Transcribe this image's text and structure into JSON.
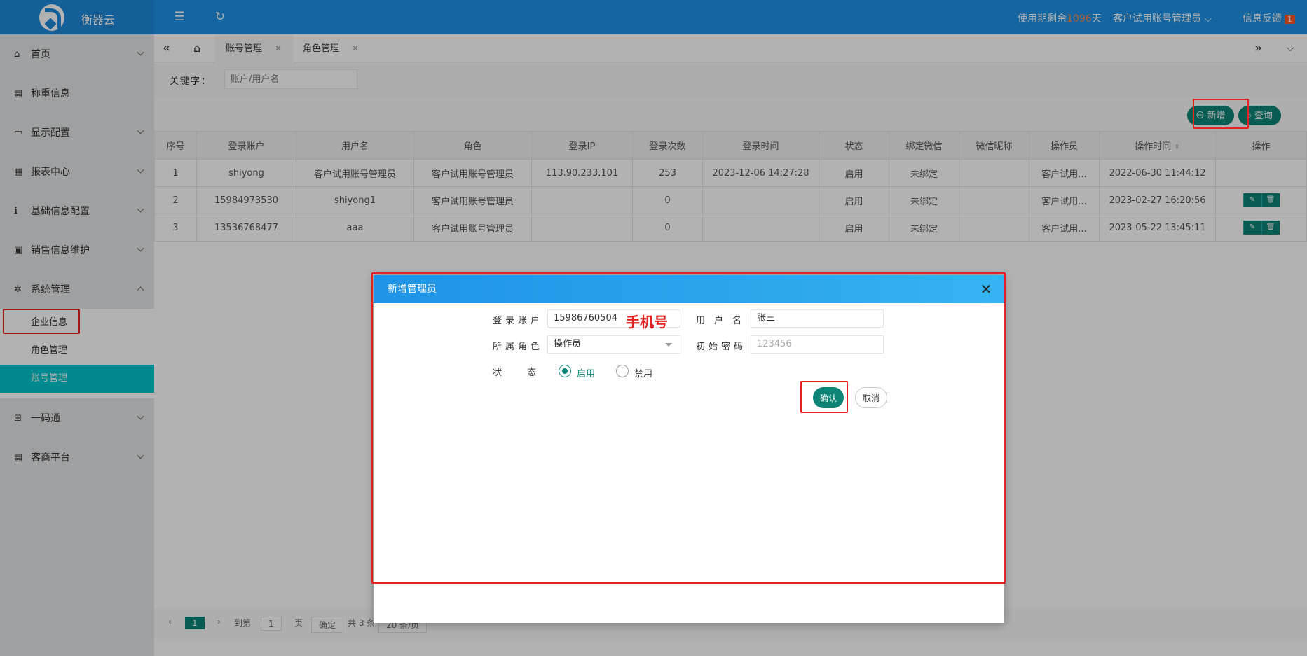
{
  "app": {
    "title": "衡器云"
  },
  "header": {
    "trial_prefix": "使用期剩余",
    "trial_days": "1096",
    "trial_suffix": "天",
    "user": "客户试用账号管理员",
    "feedback": "信息反馈",
    "feedback_count": "1"
  },
  "sidebar": {
    "items": [
      {
        "label": "首页",
        "icon": "home-icon"
      },
      {
        "label": "称重信息",
        "icon": "weigh-icon"
      },
      {
        "label": "显示配置",
        "icon": "monitor-icon"
      },
      {
        "label": "报表中心",
        "icon": "report-icon"
      },
      {
        "label": "基础信息配置",
        "icon": "info-icon"
      },
      {
        "label": "销售信息维护",
        "icon": "sales-icon"
      },
      {
        "label": "系统管理",
        "icon": "gear-icon"
      },
      {
        "label": "一码通",
        "icon": "qrcode-icon"
      },
      {
        "label": "客商平台",
        "icon": "platform-icon"
      }
    ],
    "sub_items": [
      "企业信息",
      "角色管理",
      "账号管理"
    ]
  },
  "tabs": [
    "账号管理",
    "角色管理"
  ],
  "search": {
    "label": "关键字：",
    "placeholder": "账户/用户名"
  },
  "toolbar": {
    "add": "新增",
    "query": "查询"
  },
  "table": {
    "headers": [
      "序号",
      "登录账户",
      "用户名",
      "角色",
      "登录IP",
      "登录次数",
      "登录时间",
      "状态",
      "绑定微信",
      "微信昵称",
      "操作员",
      "操作时间",
      "操作"
    ],
    "rows": [
      [
        "1",
        "shiyong",
        "客户试用账号管理员",
        "客户试用账号管理员",
        "113.90.233.101",
        "253",
        "2023-12-06 14:27:28",
        "启用",
        "未绑定",
        "",
        "客户试用...",
        "2022-06-30 11:44:12"
      ],
      [
        "2",
        "15984973530",
        "shiyong1",
        "客户试用账号管理员",
        "",
        "0",
        "",
        "启用",
        "未绑定",
        "",
        "客户试用...",
        "2023-02-27 16:20:56"
      ],
      [
        "3",
        "13536768477",
        "aaa",
        "客户试用账号管理员",
        "",
        "0",
        "",
        "启用",
        "未绑定",
        "",
        "客户试用...",
        "2023-05-22 13:45:11"
      ]
    ]
  },
  "pager": {
    "current": "1",
    "goto": "到第",
    "page_value": "1",
    "page_unit": "页",
    "confirm": "确定",
    "total": "共 3 条",
    "per_page": "20 条/页"
  },
  "dialog": {
    "title": "新增管理员",
    "account_label": "登录账户",
    "account_value": "15986760504",
    "note": "手机号",
    "username_label": "用户名",
    "username_value": "张三",
    "role_label": "所属角色",
    "role_value": "操作员",
    "password_label": "初始密码",
    "password_placeholder": "123456",
    "status_label": "状态",
    "enable": "启用",
    "disable": "禁用",
    "ok": "确认",
    "cancel": "取消"
  }
}
